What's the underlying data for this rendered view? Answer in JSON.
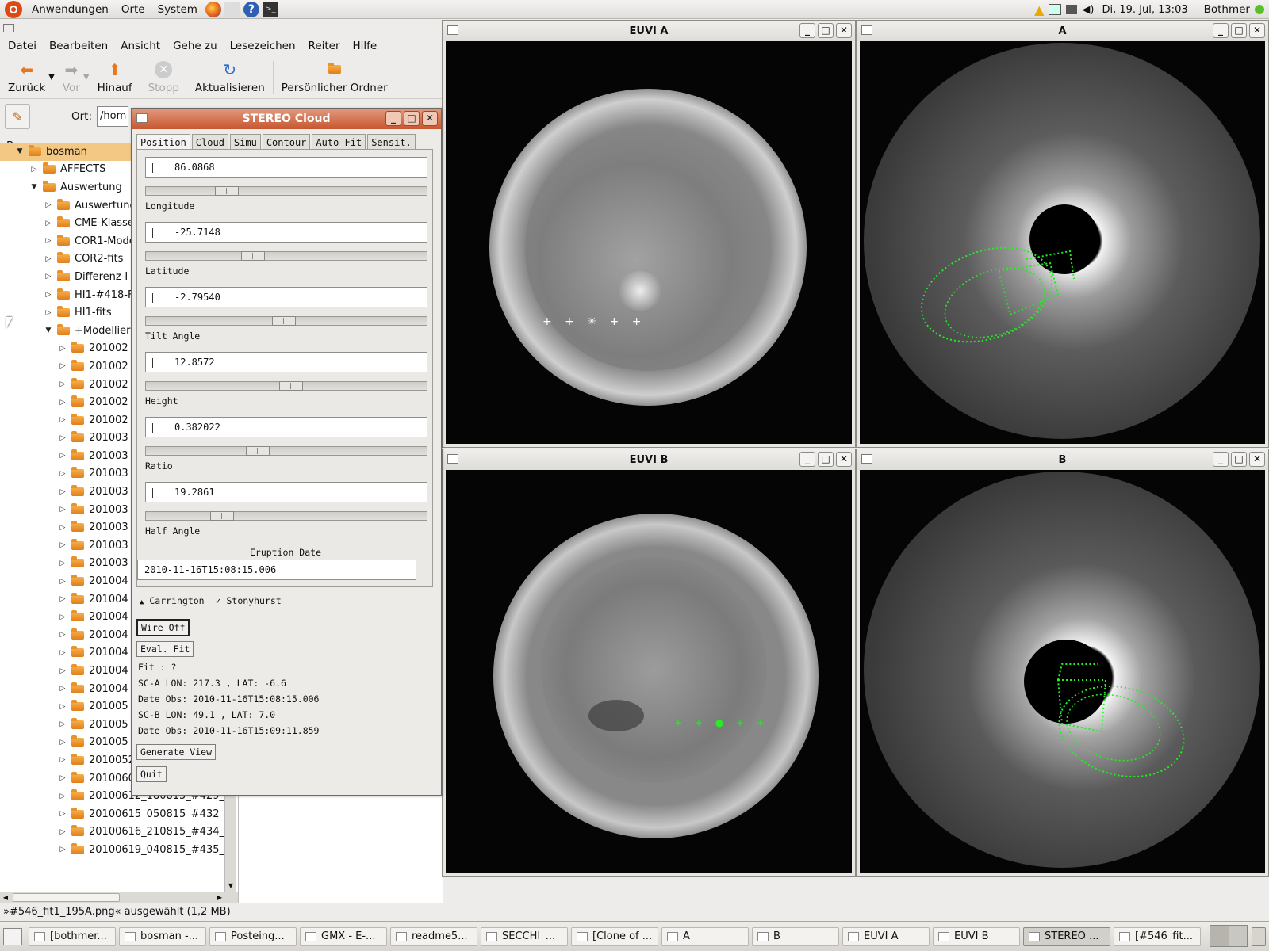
{
  "topbar": {
    "menus": [
      "Anwendungen",
      "Orte",
      "System"
    ],
    "clock": "Di, 19. Jul, 13:03",
    "user": "Bothmer"
  },
  "filemanager": {
    "menus": [
      "Datei",
      "Bearbeiten",
      "Ansicht",
      "Gehe zu",
      "Lesezeichen",
      "Reiter",
      "Hilfe"
    ],
    "toolbar": {
      "back": "Zurück",
      "forward": "Vor",
      "up": "Hinauf",
      "stop": "Stopp",
      "reload": "Aktualisieren",
      "home": "Persönlicher Ordner"
    },
    "location_label": "Ort:",
    "location_value": "/hom",
    "sidebar_mode": "Baum",
    "tree": [
      {
        "label": "bosman",
        "level": 0,
        "expanded": true,
        "selected": true
      },
      {
        "label": "AFFECTS",
        "level": 1,
        "expanded": false
      },
      {
        "label": "Auswertung",
        "level": 1,
        "expanded": true
      },
      {
        "label": "Auswertung",
        "level": 2,
        "expanded": false
      },
      {
        "label": "CME-Klasse",
        "level": 2,
        "expanded": false
      },
      {
        "label": "COR1-Mode",
        "level": 2,
        "expanded": false
      },
      {
        "label": "COR2-fits",
        "level": 2,
        "expanded": false
      },
      {
        "label": "Differenz-I",
        "level": 2,
        "expanded": false
      },
      {
        "label": "HI1-#418-F",
        "level": 2,
        "expanded": false
      },
      {
        "label": "HI1-fits",
        "level": 2,
        "expanded": false
      },
      {
        "label": "+Modellier",
        "level": 2,
        "expanded": true
      },
      {
        "label": "201002",
        "level": 3,
        "expanded": false
      },
      {
        "label": "201002",
        "level": 3,
        "expanded": false
      },
      {
        "label": "201002",
        "level": 3,
        "expanded": false
      },
      {
        "label": "201002",
        "level": 3,
        "expanded": false
      },
      {
        "label": "201002",
        "level": 3,
        "expanded": false
      },
      {
        "label": "201003",
        "level": 3,
        "expanded": false
      },
      {
        "label": "201003",
        "level": 3,
        "expanded": false
      },
      {
        "label": "201003",
        "level": 3,
        "expanded": false
      },
      {
        "label": "201003",
        "level": 3,
        "expanded": false
      },
      {
        "label": "201003",
        "level": 3,
        "expanded": false
      },
      {
        "label": "201003",
        "level": 3,
        "expanded": false
      },
      {
        "label": "201003",
        "level": 3,
        "expanded": false
      },
      {
        "label": "201003",
        "level": 3,
        "expanded": false
      },
      {
        "label": "201004",
        "level": 3,
        "expanded": false
      },
      {
        "label": "201004",
        "level": 3,
        "expanded": false
      },
      {
        "label": "201004",
        "level": 3,
        "expanded": false
      },
      {
        "label": "201004",
        "level": 3,
        "expanded": false
      },
      {
        "label": "201004",
        "level": 3,
        "expanded": false
      },
      {
        "label": "201004",
        "level": 3,
        "expanded": false
      },
      {
        "label": "201004",
        "level": 3,
        "expanded": false
      },
      {
        "label": "201005",
        "level": 3,
        "expanded": false
      },
      {
        "label": "201005",
        "level": 3,
        "expanded": false
      },
      {
        "label": "201005",
        "level": 3,
        "expanded": false
      },
      {
        "label": "20100524_170815_#418_",
        "level": 3,
        "expanded": false
      },
      {
        "label": "20100604_160815_#426_",
        "level": 3,
        "expanded": false
      },
      {
        "label": "20100612_180815_#429_",
        "level": 3,
        "expanded": false
      },
      {
        "label": "20100615_050815_#432_",
        "level": 3,
        "expanded": false
      },
      {
        "label": "20100616_210815_#434_",
        "level": 3,
        "expanded": false
      },
      {
        "label": "20100619_040815_#435_",
        "level": 3,
        "expanded": false
      }
    ],
    "status": "»#546_fit1_195A.png« ausgewählt (1,2 MB)"
  },
  "stereo": {
    "title": "STEREO Cloud",
    "tabs": [
      "Position",
      "Cloud",
      "Simu",
      "Contour",
      "Auto Fit",
      "Sensit."
    ],
    "params": [
      {
        "label": "Longitude",
        "value": "86.0868",
        "slider": 0.27
      },
      {
        "label": "Latitude",
        "value": "-25.7148",
        "slider": 0.37
      },
      {
        "label": "Tilt Angle",
        "value": "-2.79540",
        "slider": 0.49
      },
      {
        "label": "Height",
        "value": "12.8572",
        "slider": 0.52
      },
      {
        "label": "Ratio",
        "value": "0.382022",
        "slider": 0.39
      },
      {
        "label": "Half Angle",
        "value": "19.2861",
        "slider": 0.25
      }
    ],
    "eruption_label": "Eruption Date",
    "eruption_value": "2010-11-16T15:08:15.006",
    "coord_options": [
      "Carrington",
      "Stonyhurst"
    ],
    "wire_btn": "Wire Off",
    "eval_btn": "Eval. Fit",
    "fit": "Fit : ?",
    "sca": "SC-A LON:  217.3 , LAT:  -6.6",
    "date_a": "Date Obs: 2010-11-16T15:08:15.006",
    "scb": "SC-B LON:   49.1 , LAT:   7.0",
    "date_b": "Date Obs: 2010-11-16T15:09:11.859",
    "generate_btn": "Generate View",
    "quit_btn": "Quit"
  },
  "views": {
    "euvi_a": "EUVI A",
    "cor_a": "A",
    "euvi_b": "EUVI B",
    "cor_b": "B"
  },
  "taskbar": [
    "[bothmer...",
    "bosman -...",
    "Posteing...",
    "GMX - E-...",
    "readme5...",
    "SECCHI_...",
    "[Clone of ...",
    "A",
    "B",
    "EUVI A",
    "EUVI B",
    "STEREO ...",
    "[#546_fit..."
  ],
  "colors": {
    "fit_wireframe": "#22ee22",
    "selection": "#f3c885",
    "titlebar_active": "#c7562f"
  }
}
